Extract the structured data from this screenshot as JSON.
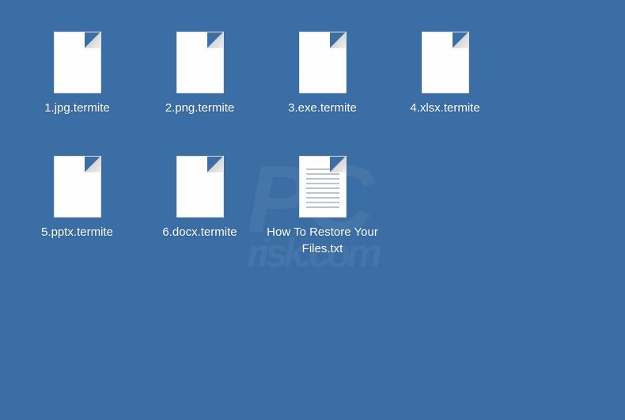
{
  "files": [
    {
      "label": "1.jpg.termite",
      "type": "blank"
    },
    {
      "label": "2.png.termite",
      "type": "blank"
    },
    {
      "label": "3.exe.termite",
      "type": "blank"
    },
    {
      "label": "4.xlsx.termite",
      "type": "blank"
    },
    {
      "label": "5.pptx.termite",
      "type": "blank"
    },
    {
      "label": "6.docx.termite",
      "type": "blank"
    },
    {
      "label": "How To Restore Your Files.txt",
      "type": "text"
    }
  ],
  "watermark": {
    "main": "PC",
    "sub": "risk.com"
  }
}
